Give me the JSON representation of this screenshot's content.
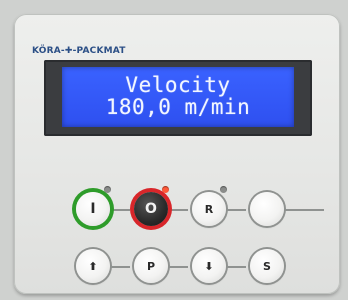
{
  "brand": {
    "logo_text": "KÖRA-✚-PACKMAT"
  },
  "display": {
    "line1": "Velocity",
    "line2": "180,0 m/min"
  },
  "keys_row1": {
    "on_label": "I",
    "off_label": "O",
    "reset_label": "R",
    "blank_label": ""
  },
  "keys_row2": {
    "up_label": "⬆",
    "p_label": "P",
    "down_label": "⬇",
    "s_label": "S"
  },
  "colors": {
    "on_rim": "#2e9c2a",
    "off_rim": "#d8262a",
    "lcd_bg": "#2e50f0",
    "lcd_text": "#f2f6ff"
  }
}
